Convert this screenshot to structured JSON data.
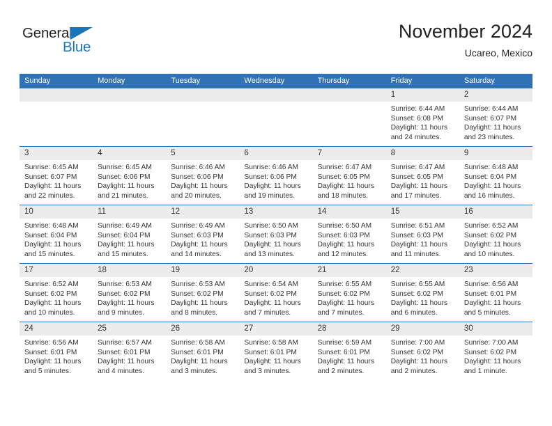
{
  "brand": {
    "name_part1": "General",
    "name_part2": "Blue",
    "triangle_color": "#1b75bb",
    "text_color": "#231f20"
  },
  "header": {
    "title": "November 2024",
    "subtitle": "Ucareo, Mexico"
  },
  "colors": {
    "header_bar": "#2f72b6",
    "date_strip": "#ececec",
    "row_divider": "#2f72b6",
    "text": "#333333"
  },
  "weekday_headers": [
    "Sunday",
    "Monday",
    "Tuesday",
    "Wednesday",
    "Thursday",
    "Friday",
    "Saturday"
  ],
  "labels": {
    "sunrise_prefix": "Sunrise:",
    "sunset_prefix": "Sunset:",
    "daylight_prefix": "Daylight:"
  },
  "weeks": [
    [
      {
        "day": "",
        "sunrise": "",
        "sunset": "",
        "daylight_line1": "",
        "daylight_line2": "",
        "empty": true
      },
      {
        "day": "",
        "sunrise": "",
        "sunset": "",
        "daylight_line1": "",
        "daylight_line2": "",
        "empty": true
      },
      {
        "day": "",
        "sunrise": "",
        "sunset": "",
        "daylight_line1": "",
        "daylight_line2": "",
        "empty": true
      },
      {
        "day": "",
        "sunrise": "",
        "sunset": "",
        "daylight_line1": "",
        "daylight_line2": "",
        "empty": true
      },
      {
        "day": "",
        "sunrise": "",
        "sunset": "",
        "daylight_line1": "",
        "daylight_line2": "",
        "empty": true
      },
      {
        "day": "1",
        "sunrise": "Sunrise: 6:44 AM",
        "sunset": "Sunset: 6:08 PM",
        "daylight_line1": "Daylight: 11 hours",
        "daylight_line2": "and 24 minutes.",
        "empty": false
      },
      {
        "day": "2",
        "sunrise": "Sunrise: 6:44 AM",
        "sunset": "Sunset: 6:07 PM",
        "daylight_line1": "Daylight: 11 hours",
        "daylight_line2": "and 23 minutes.",
        "empty": false
      }
    ],
    [
      {
        "day": "3",
        "sunrise": "Sunrise: 6:45 AM",
        "sunset": "Sunset: 6:07 PM",
        "daylight_line1": "Daylight: 11 hours",
        "daylight_line2": "and 22 minutes.",
        "empty": false
      },
      {
        "day": "4",
        "sunrise": "Sunrise: 6:45 AM",
        "sunset": "Sunset: 6:06 PM",
        "daylight_line1": "Daylight: 11 hours",
        "daylight_line2": "and 21 minutes.",
        "empty": false
      },
      {
        "day": "5",
        "sunrise": "Sunrise: 6:46 AM",
        "sunset": "Sunset: 6:06 PM",
        "daylight_line1": "Daylight: 11 hours",
        "daylight_line2": "and 20 minutes.",
        "empty": false
      },
      {
        "day": "6",
        "sunrise": "Sunrise: 6:46 AM",
        "sunset": "Sunset: 6:06 PM",
        "daylight_line1": "Daylight: 11 hours",
        "daylight_line2": "and 19 minutes.",
        "empty": false
      },
      {
        "day": "7",
        "sunrise": "Sunrise: 6:47 AM",
        "sunset": "Sunset: 6:05 PM",
        "daylight_line1": "Daylight: 11 hours",
        "daylight_line2": "and 18 minutes.",
        "empty": false
      },
      {
        "day": "8",
        "sunrise": "Sunrise: 6:47 AM",
        "sunset": "Sunset: 6:05 PM",
        "daylight_line1": "Daylight: 11 hours",
        "daylight_line2": "and 17 minutes.",
        "empty": false
      },
      {
        "day": "9",
        "sunrise": "Sunrise: 6:48 AM",
        "sunset": "Sunset: 6:04 PM",
        "daylight_line1": "Daylight: 11 hours",
        "daylight_line2": "and 16 minutes.",
        "empty": false
      }
    ],
    [
      {
        "day": "10",
        "sunrise": "Sunrise: 6:48 AM",
        "sunset": "Sunset: 6:04 PM",
        "daylight_line1": "Daylight: 11 hours",
        "daylight_line2": "and 15 minutes.",
        "empty": false
      },
      {
        "day": "11",
        "sunrise": "Sunrise: 6:49 AM",
        "sunset": "Sunset: 6:04 PM",
        "daylight_line1": "Daylight: 11 hours",
        "daylight_line2": "and 15 minutes.",
        "empty": false
      },
      {
        "day": "12",
        "sunrise": "Sunrise: 6:49 AM",
        "sunset": "Sunset: 6:03 PM",
        "daylight_line1": "Daylight: 11 hours",
        "daylight_line2": "and 14 minutes.",
        "empty": false
      },
      {
        "day": "13",
        "sunrise": "Sunrise: 6:50 AM",
        "sunset": "Sunset: 6:03 PM",
        "daylight_line1": "Daylight: 11 hours",
        "daylight_line2": "and 13 minutes.",
        "empty": false
      },
      {
        "day": "14",
        "sunrise": "Sunrise: 6:50 AM",
        "sunset": "Sunset: 6:03 PM",
        "daylight_line1": "Daylight: 11 hours",
        "daylight_line2": "and 12 minutes.",
        "empty": false
      },
      {
        "day": "15",
        "sunrise": "Sunrise: 6:51 AM",
        "sunset": "Sunset: 6:03 PM",
        "daylight_line1": "Daylight: 11 hours",
        "daylight_line2": "and 11 minutes.",
        "empty": false
      },
      {
        "day": "16",
        "sunrise": "Sunrise: 6:52 AM",
        "sunset": "Sunset: 6:02 PM",
        "daylight_line1": "Daylight: 11 hours",
        "daylight_line2": "and 10 minutes.",
        "empty": false
      }
    ],
    [
      {
        "day": "17",
        "sunrise": "Sunrise: 6:52 AM",
        "sunset": "Sunset: 6:02 PM",
        "daylight_line1": "Daylight: 11 hours",
        "daylight_line2": "and 10 minutes.",
        "empty": false
      },
      {
        "day": "18",
        "sunrise": "Sunrise: 6:53 AM",
        "sunset": "Sunset: 6:02 PM",
        "daylight_line1": "Daylight: 11 hours",
        "daylight_line2": "and 9 minutes.",
        "empty": false
      },
      {
        "day": "19",
        "sunrise": "Sunrise: 6:53 AM",
        "sunset": "Sunset: 6:02 PM",
        "daylight_line1": "Daylight: 11 hours",
        "daylight_line2": "and 8 minutes.",
        "empty": false
      },
      {
        "day": "20",
        "sunrise": "Sunrise: 6:54 AM",
        "sunset": "Sunset: 6:02 PM",
        "daylight_line1": "Daylight: 11 hours",
        "daylight_line2": "and 7 minutes.",
        "empty": false
      },
      {
        "day": "21",
        "sunrise": "Sunrise: 6:55 AM",
        "sunset": "Sunset: 6:02 PM",
        "daylight_line1": "Daylight: 11 hours",
        "daylight_line2": "and 7 minutes.",
        "empty": false
      },
      {
        "day": "22",
        "sunrise": "Sunrise: 6:55 AM",
        "sunset": "Sunset: 6:02 PM",
        "daylight_line1": "Daylight: 11 hours",
        "daylight_line2": "and 6 minutes.",
        "empty": false
      },
      {
        "day": "23",
        "sunrise": "Sunrise: 6:56 AM",
        "sunset": "Sunset: 6:01 PM",
        "daylight_line1": "Daylight: 11 hours",
        "daylight_line2": "and 5 minutes.",
        "empty": false
      }
    ],
    [
      {
        "day": "24",
        "sunrise": "Sunrise: 6:56 AM",
        "sunset": "Sunset: 6:01 PM",
        "daylight_line1": "Daylight: 11 hours",
        "daylight_line2": "and 5 minutes.",
        "empty": false
      },
      {
        "day": "25",
        "sunrise": "Sunrise: 6:57 AM",
        "sunset": "Sunset: 6:01 PM",
        "daylight_line1": "Daylight: 11 hours",
        "daylight_line2": "and 4 minutes.",
        "empty": false
      },
      {
        "day": "26",
        "sunrise": "Sunrise: 6:58 AM",
        "sunset": "Sunset: 6:01 PM",
        "daylight_line1": "Daylight: 11 hours",
        "daylight_line2": "and 3 minutes.",
        "empty": false
      },
      {
        "day": "27",
        "sunrise": "Sunrise: 6:58 AM",
        "sunset": "Sunset: 6:01 PM",
        "daylight_line1": "Daylight: 11 hours",
        "daylight_line2": "and 3 minutes.",
        "empty": false
      },
      {
        "day": "28",
        "sunrise": "Sunrise: 6:59 AM",
        "sunset": "Sunset: 6:01 PM",
        "daylight_line1": "Daylight: 11 hours",
        "daylight_line2": "and 2 minutes.",
        "empty": false
      },
      {
        "day": "29",
        "sunrise": "Sunrise: 7:00 AM",
        "sunset": "Sunset: 6:02 PM",
        "daylight_line1": "Daylight: 11 hours",
        "daylight_line2": "and 2 minutes.",
        "empty": false
      },
      {
        "day": "30",
        "sunrise": "Sunrise: 7:00 AM",
        "sunset": "Sunset: 6:02 PM",
        "daylight_line1": "Daylight: 11 hours",
        "daylight_line2": "and 1 minute.",
        "empty": false
      }
    ]
  ]
}
